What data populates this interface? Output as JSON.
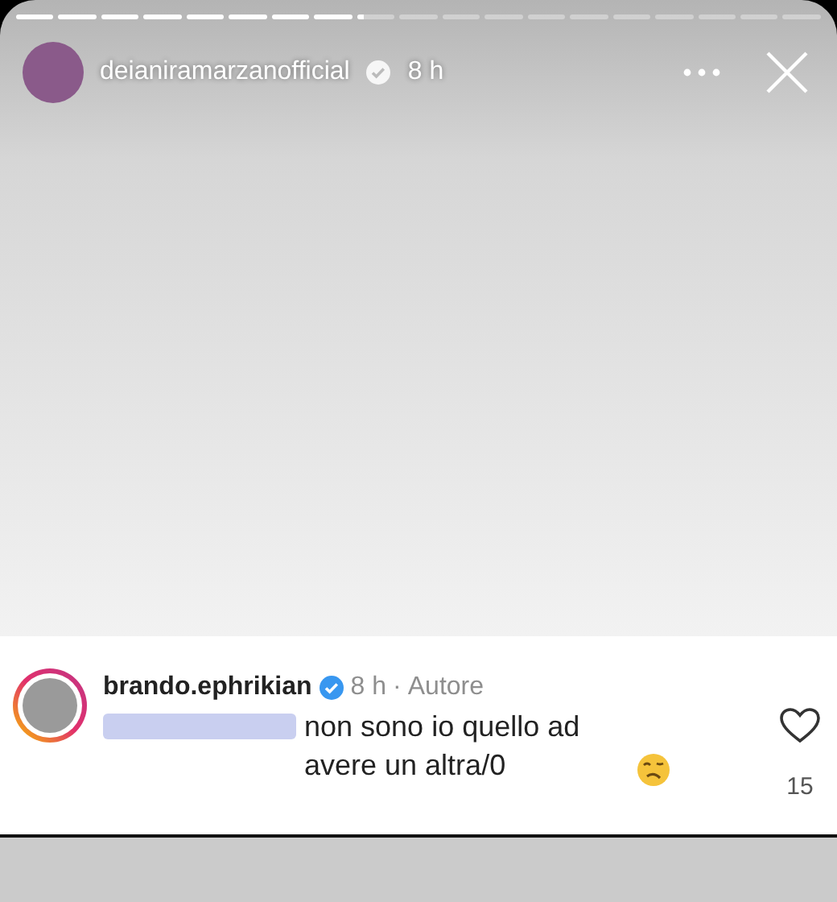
{
  "story_segments": [
    {
      "level": 1
    },
    {
      "level": 1
    },
    {
      "level": 1
    },
    {
      "level": 1
    },
    {
      "level": 1
    },
    {
      "level": 1
    },
    {
      "level": 1
    },
    {
      "level": 1
    },
    {
      "level": 0.2
    },
    {
      "level": 0
    },
    {
      "level": 0
    },
    {
      "level": 0
    },
    {
      "level": 0
    },
    {
      "level": 0
    },
    {
      "level": 0
    },
    {
      "level": 0
    },
    {
      "level": 0
    },
    {
      "level": 0
    },
    {
      "level": 0
    }
  ],
  "header": {
    "username": "deianiramarzanofficial",
    "verified": true,
    "time": "8 h"
  },
  "comment": {
    "username": "brando.ephrikian",
    "verified": true,
    "time": "8 h",
    "separator": "·",
    "role": "Autore",
    "mention_obscured": true,
    "text": "non sono io quello ad avere un altra/0",
    "liked": false,
    "likes": "15"
  }
}
